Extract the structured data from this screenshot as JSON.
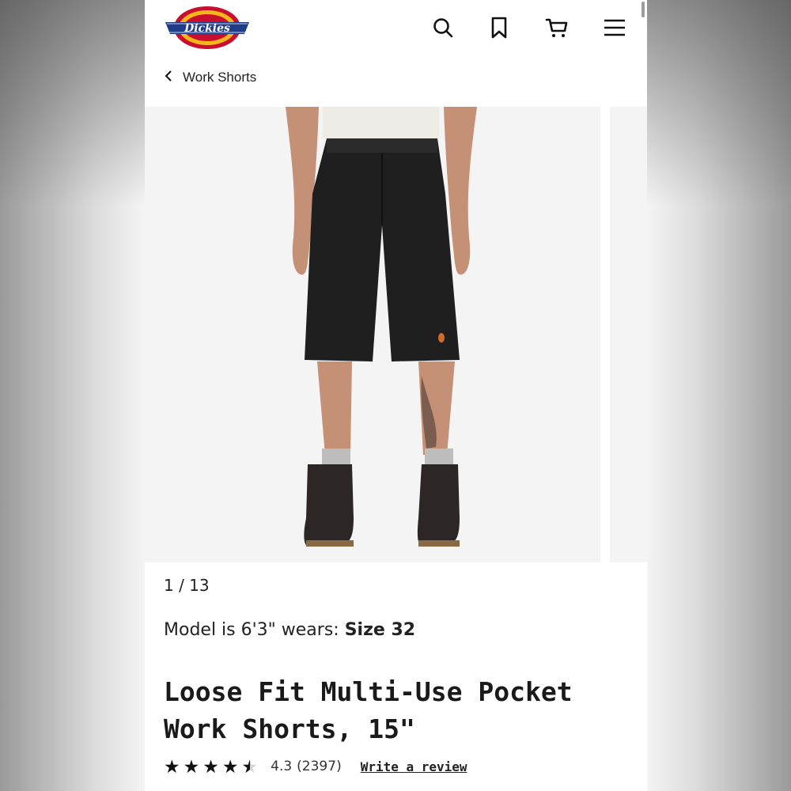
{
  "brand": {
    "name": "Dickies"
  },
  "header": {
    "icons": [
      "search-icon",
      "bookmark-icon",
      "cart-icon",
      "menu-icon"
    ]
  },
  "breadcrumb": {
    "label": "Work Shorts"
  },
  "gallery": {
    "counter": "1 / 13"
  },
  "model_info": {
    "prefix": "Model is 6'3\" wears: ",
    "size": "Size 32"
  },
  "product": {
    "title_line1": "Loose Fit Multi-Use Pocket",
    "title_line2": "Work Shorts, 15\""
  },
  "rating": {
    "stars": 4.3,
    "value": "4.3",
    "count": "(2397)",
    "write_review": "Write a review"
  },
  "colors": {
    "logo_red": "#c8102e",
    "logo_yellow": "#f6b519",
    "logo_blue": "#1f3c88",
    "text": "#1a1a1a"
  }
}
